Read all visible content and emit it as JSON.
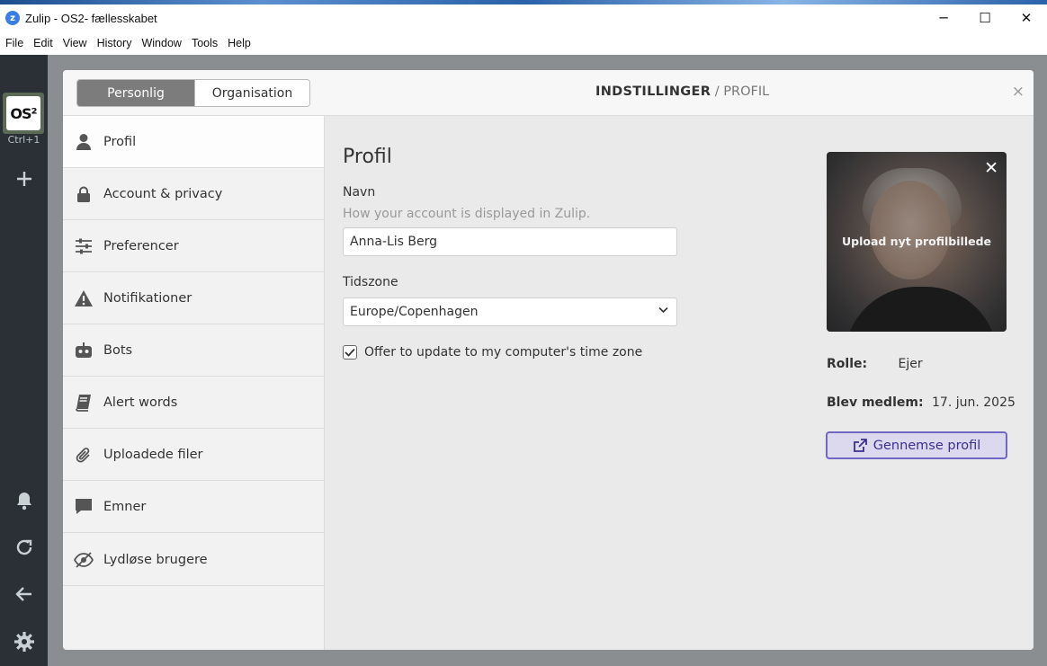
{
  "window": {
    "title": "Zulip - OS2- fællesskabet",
    "minimize": "─",
    "maximize": "☐",
    "close": "✕"
  },
  "menubar": [
    "File",
    "Edit",
    "View",
    "History",
    "Window",
    "Tools",
    "Help"
  ],
  "rail": {
    "org_logo": "OS²",
    "org_shortcut": "Ctrl+1",
    "icons": [
      "add-icon",
      "bell-icon",
      "reload-icon",
      "back-arrow-icon",
      "gear-icon"
    ]
  },
  "settings": {
    "tabs": {
      "personal": "Personlig",
      "organisation": "Organisation"
    },
    "header": {
      "section": "INDSTILLINGER",
      "separator": " / ",
      "page": "PROFIL"
    },
    "close": "×",
    "nav": [
      {
        "label": "Profil",
        "icon": "user-icon"
      },
      {
        "label": "Account & privacy",
        "icon": "lock-icon"
      },
      {
        "label": "Preferencer",
        "icon": "sliders-icon"
      },
      {
        "label": "Notifikationer",
        "icon": "warning-icon"
      },
      {
        "label": "Bots",
        "icon": "robot-icon"
      },
      {
        "label": "Alert words",
        "icon": "book-icon"
      },
      {
        "label": "Uploadede filer",
        "icon": "paperclip-icon"
      },
      {
        "label": "Emner",
        "icon": "message-icon"
      },
      {
        "label": "Lydløse brugere",
        "icon": "eye-slash-icon"
      }
    ],
    "profile": {
      "heading": "Profil",
      "name_label": "Navn",
      "name_hint": "How your account is displayed in Zulip.",
      "name_value": "Anna-Lis Berg",
      "timezone_label": "Tidszone",
      "timezone_value": "Europe/Copenhagen",
      "offer_update_label": "Offer to update to my computer's time zone",
      "offer_update_checked": true,
      "avatar_upload": "Upload nyt profilbillede",
      "avatar_close": "✕",
      "role_label": "Rolle:",
      "role_value": "Ejer",
      "joined_label": "Blev medlem:",
      "joined_value": "17. jun. 2025",
      "view_profile": "Gennemse profil"
    }
  }
}
